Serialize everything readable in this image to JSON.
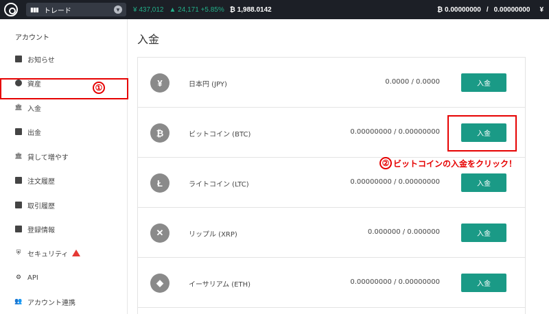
{
  "topbar": {
    "mode": "トレード",
    "jpy_price": "¥ 437,012",
    "change": "▲ 24,171 +5.85%",
    "btc_price": "₿ 1,988.0142",
    "balance_btc": "₿ 0.00000000",
    "balance_sep": "/",
    "balance_btc2": "0.00000000",
    "balance_yen": "¥"
  },
  "sidebar": {
    "header": "アカウント",
    "items": [
      {
        "label": "お知らせ"
      },
      {
        "label": "資産"
      },
      {
        "label": "入金"
      },
      {
        "label": "出金"
      },
      {
        "label": "貸して増やす"
      },
      {
        "label": "注文履歴"
      },
      {
        "label": "取引履歴"
      },
      {
        "label": "登録情報"
      },
      {
        "label": "セキュリティ"
      },
      {
        "label": "API"
      },
      {
        "label": "アカウント連携"
      }
    ]
  },
  "annotations": {
    "step1": "①",
    "step2_num": "②",
    "step2_text": "ビットコインの入金をクリック！"
  },
  "main": {
    "title": "入金",
    "rows": [
      {
        "symbol": "¥",
        "name": "日本円 (JPY)",
        "amount": "0.0000 / 0.0000",
        "button": "入金"
      },
      {
        "symbol": "₿",
        "name": "ビットコイン (BTC)",
        "amount": "0.00000000 / 0.00000000",
        "button": "入金"
      },
      {
        "symbol": "Ł",
        "name": "ライトコイン (LTC)",
        "amount": "0.00000000 / 0.00000000",
        "button": "入金"
      },
      {
        "symbol": "✕",
        "name": "リップル (XRP)",
        "amount": "0.000000 / 0.000000",
        "button": "入金"
      },
      {
        "symbol": "◆",
        "name": "イーサリアム (ETH)",
        "amount": "0.00000000 / 0.00000000",
        "button": "入金"
      }
    ]
  }
}
